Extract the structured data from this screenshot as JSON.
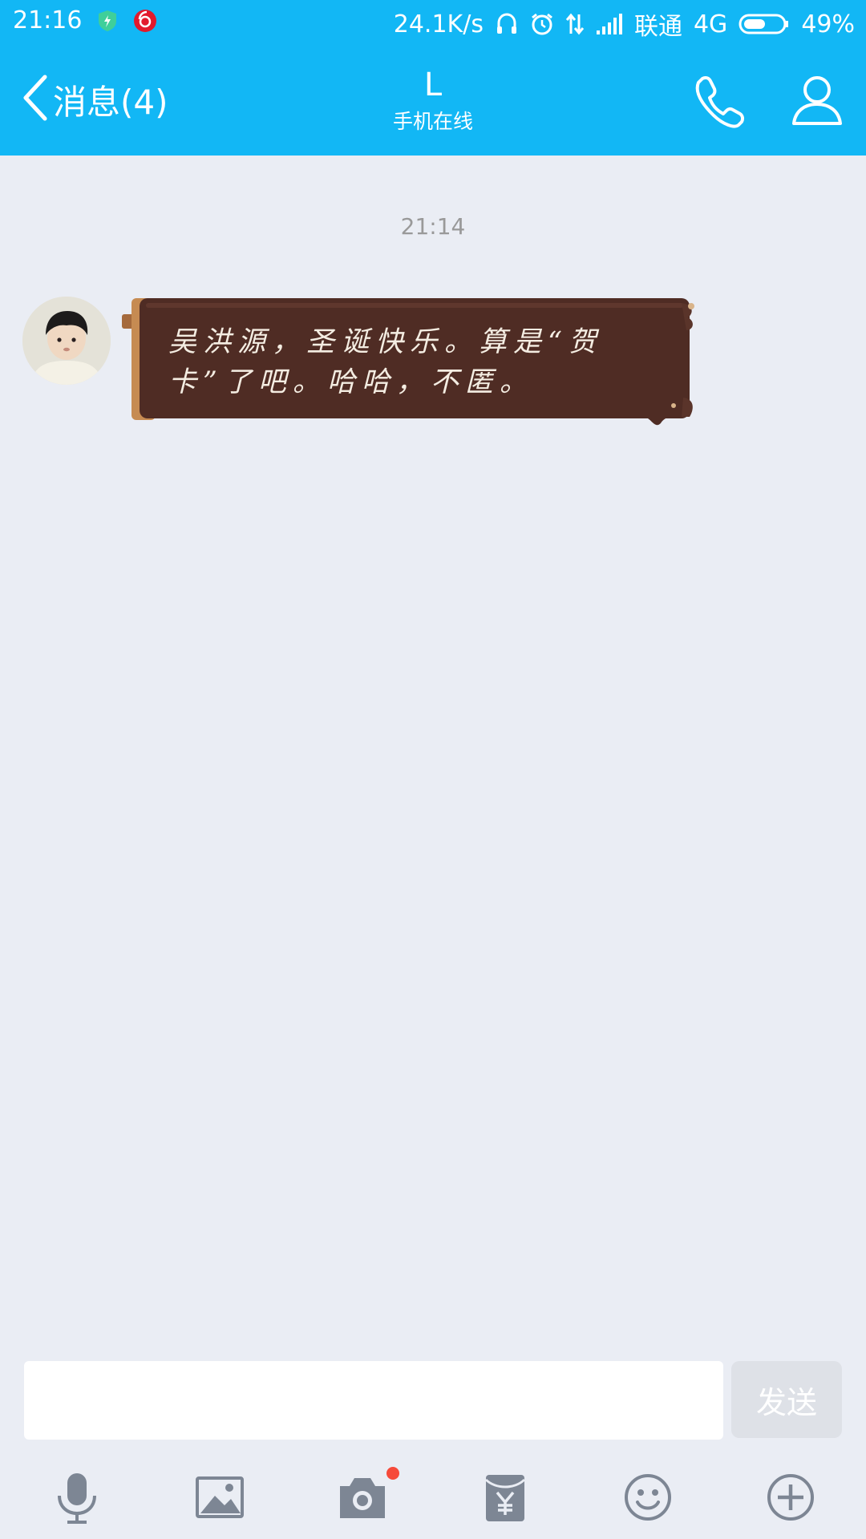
{
  "status_bar": {
    "time": "21:16",
    "speed": "24.1K/s",
    "carrier": "联通",
    "network": "4G",
    "battery": "49%",
    "icons": [
      "security-shield-icon",
      "netease-music-icon",
      "headphones-icon",
      "alarm-icon",
      "data-transfer-icon",
      "signal-icon",
      "battery-icon"
    ]
  },
  "nav": {
    "back_label": "消息(4)",
    "title": "L",
    "subtitle": "手机在线",
    "icons": [
      "back-chevron-icon",
      "phone-icon",
      "profile-icon"
    ]
  },
  "chat": {
    "timestamp": "21:14",
    "messages": [
      {
        "sender": "L",
        "text": "吴洪源，圣诞快乐。算是“贺卡”了吧。哈哈，不匿。"
      }
    ]
  },
  "input": {
    "value": "",
    "send_label": "发送"
  },
  "toolbar": {
    "items": [
      "microphone-icon",
      "image-icon",
      "camera-icon",
      "red-packet-icon",
      "emoji-icon",
      "plus-icon"
    ]
  },
  "colors": {
    "brand": "#12b7f5",
    "background": "#eaedf4",
    "bubble": "#4f2c24",
    "badge": "#f64a3a"
  }
}
